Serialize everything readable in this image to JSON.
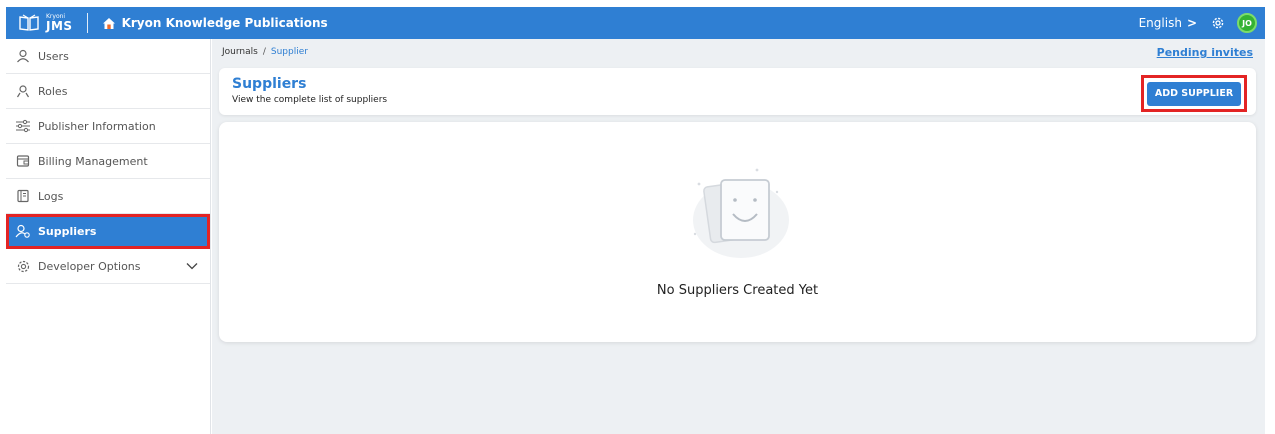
{
  "topbar": {
    "brand_small": "Kryoni",
    "brand_big": "JMS",
    "app_title": "Kryon Knowledge Publications",
    "language": "English",
    "language_chevron": ">",
    "avatar_initials": "JO"
  },
  "sidebar": {
    "items": [
      {
        "label": "Users",
        "icon": "user-icon"
      },
      {
        "label": "Roles",
        "icon": "roles-icon"
      },
      {
        "label": "Publisher Information",
        "icon": "sliders-icon"
      },
      {
        "label": "Billing Management",
        "icon": "wallet-icon"
      },
      {
        "label": "Logs",
        "icon": "logs-icon"
      },
      {
        "label": "Suppliers",
        "icon": "supplier-icon",
        "active": true
      },
      {
        "label": "Developer Options",
        "icon": "gear-icon",
        "expandable": true
      }
    ]
  },
  "breadcrumb": {
    "root": "Journals",
    "separator": "/",
    "current": "Supplier"
  },
  "pending_invites": "Pending invites",
  "header": {
    "title": "Suppliers",
    "subtitle": "View the complete list of suppliers",
    "add_button": "ADD SUPPLIER"
  },
  "empty_state": {
    "message": "No Suppliers Created Yet"
  },
  "colors": {
    "primary": "#2f7fd3",
    "highlight": "#e32424",
    "avatar": "#34b233"
  }
}
